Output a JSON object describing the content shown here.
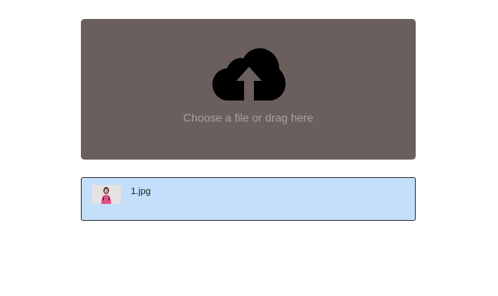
{
  "dropzone": {
    "label": "Choose a file or drag here",
    "icon": "cloud-upload-icon",
    "background_color": "#6b5f5e",
    "label_color": "#a9a09e"
  },
  "files": [
    {
      "name": "1.jpg",
      "thumbnail": "photo-thumbnail",
      "background_color": "#c3dffa"
    }
  ]
}
